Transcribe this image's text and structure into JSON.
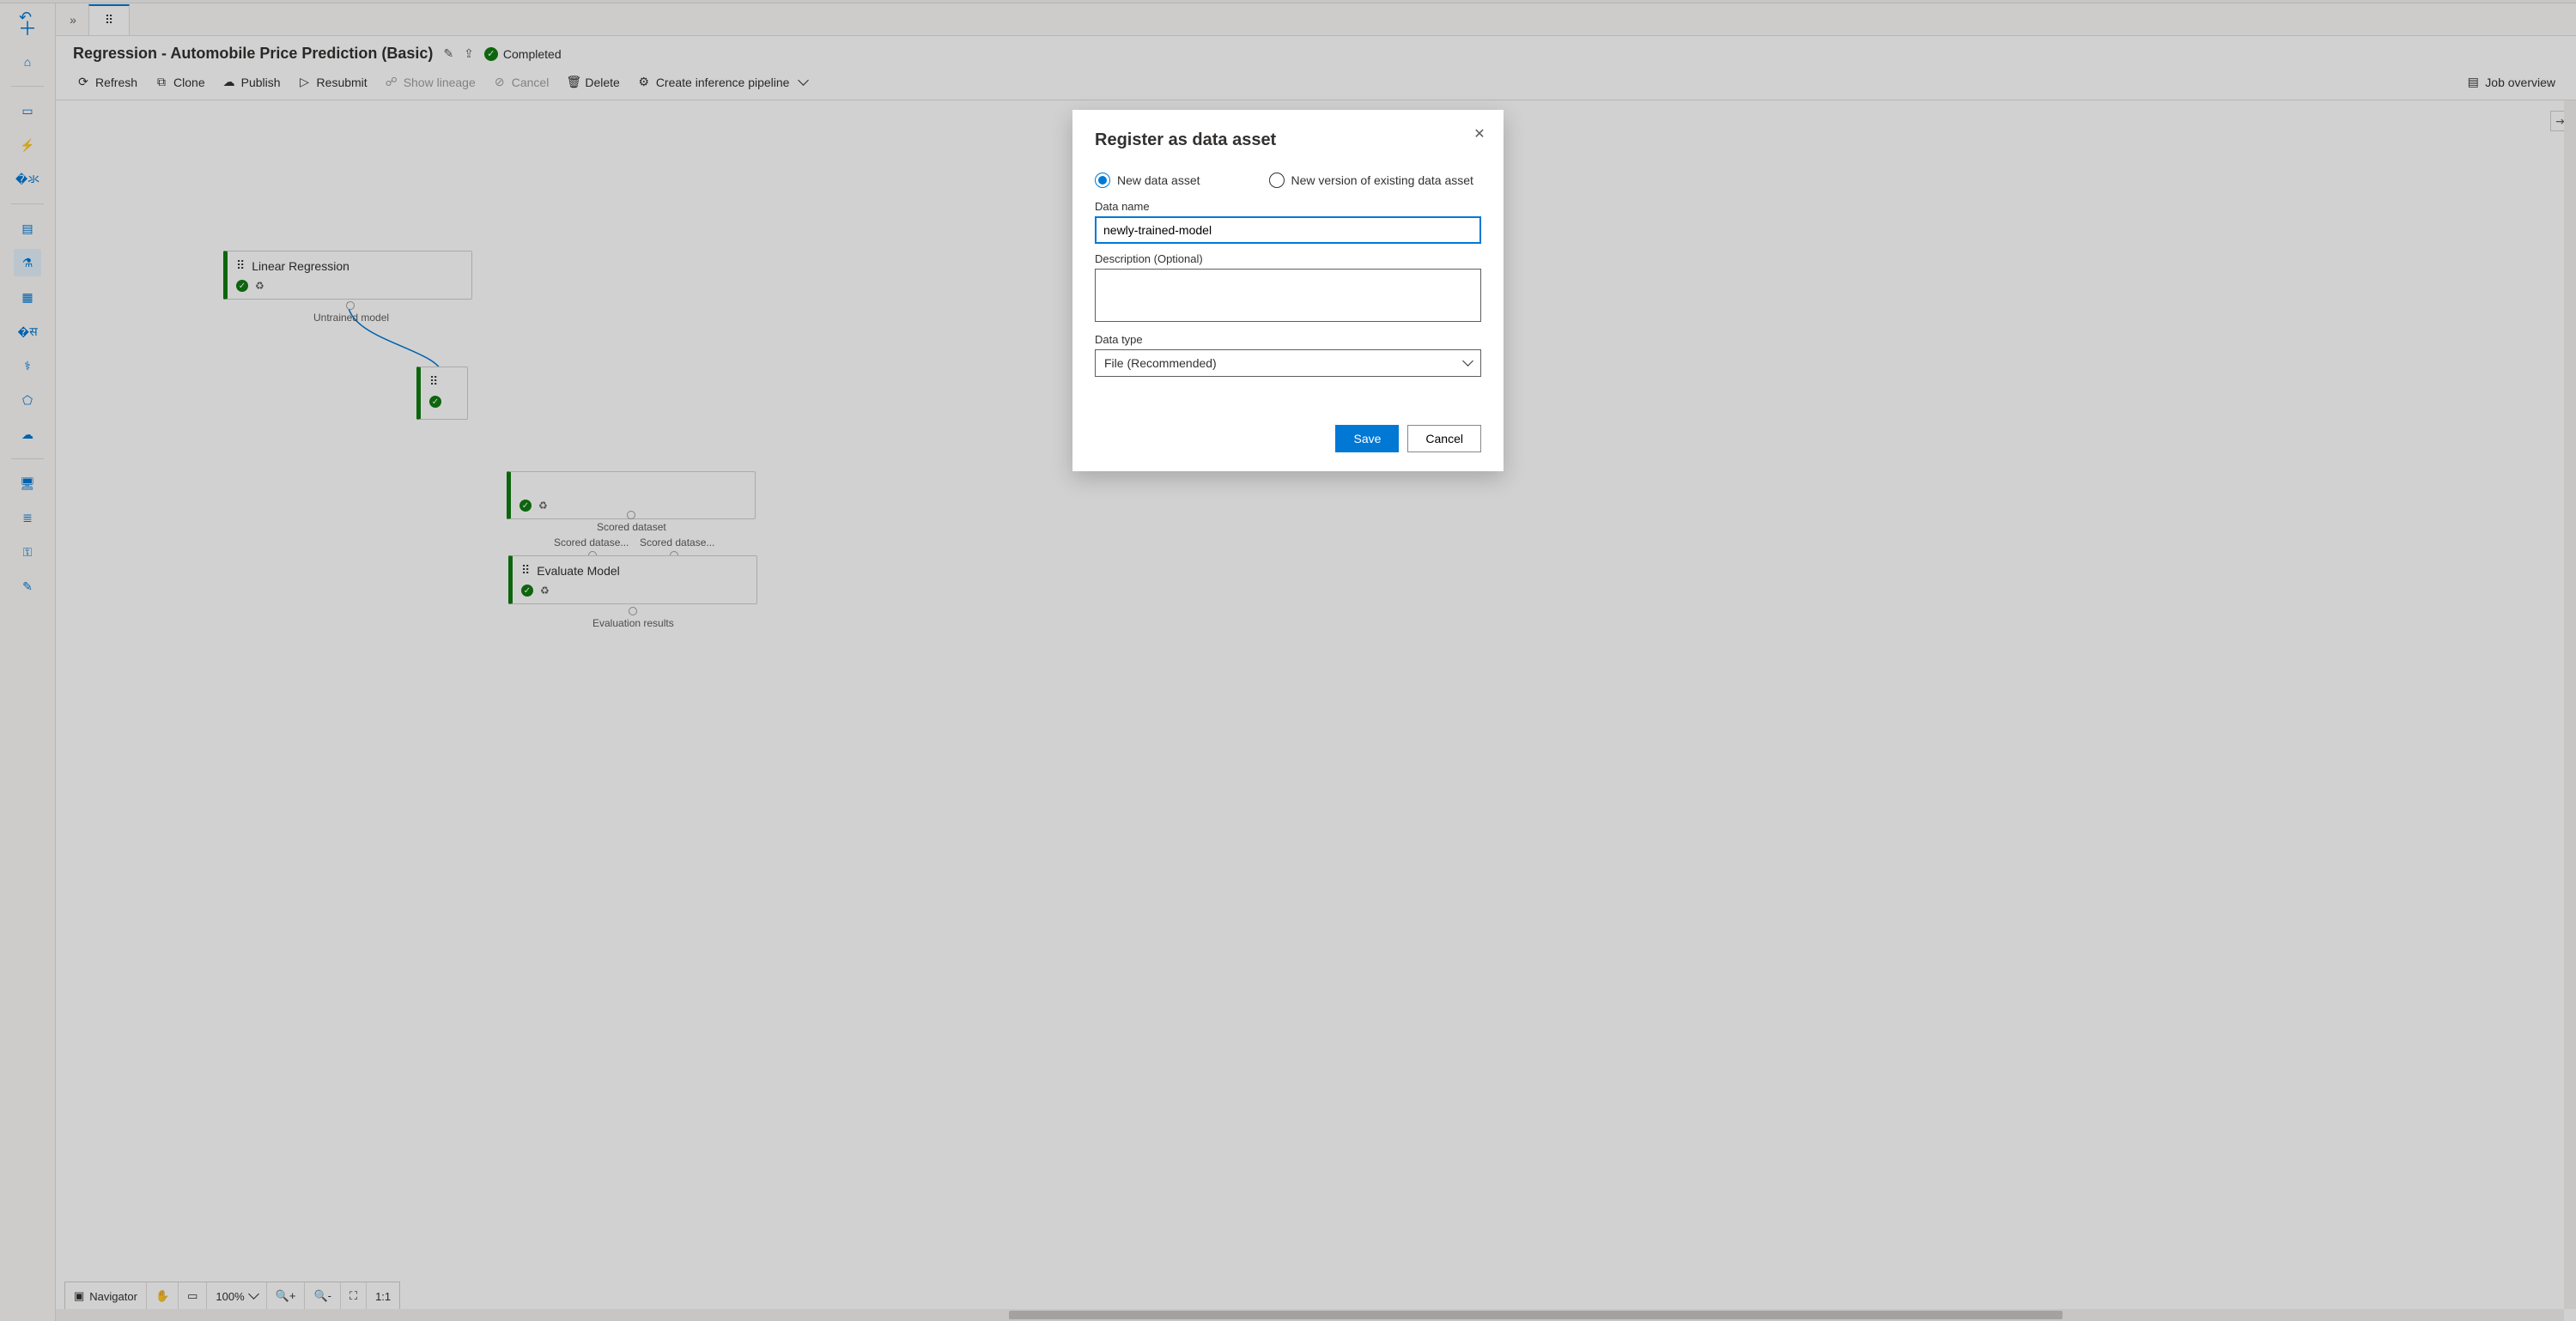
{
  "pipeline": {
    "title": "Regression - Automobile Price Prediction (Basic)",
    "status": "Completed"
  },
  "toolbar": {
    "refresh": "Refresh",
    "clone": "Clone",
    "publish": "Publish",
    "resubmit": "Resubmit",
    "show_lineage": "Show lineage",
    "cancel": "Cancel",
    "delete": "Delete",
    "create_inference": "Create inference pipeline",
    "job_overview": "Job overview"
  },
  "navigator": {
    "label": "Navigator",
    "zoom": "100%"
  },
  "nodes": {
    "linear_regression": "Linear Regression",
    "evaluate_model": "Evaluate Model"
  },
  "port_labels": {
    "untrained_model": "Untrained model",
    "scored_dataset": "Scored dataset",
    "scored_dataset_left": "Scored datase...",
    "scored_dataset_right": "Scored datase...",
    "evaluation_results": "Evaluation results"
  },
  "dialog": {
    "title": "Register as data asset",
    "radio_new": "New data asset",
    "radio_version": "New version of existing data asset",
    "data_name_label": "Data name",
    "data_name_value": "newly-trained-model",
    "description_label": "Description (Optional)",
    "description_value": "",
    "data_type_label": "Data type",
    "data_type_value": "File (Recommended)",
    "save": "Save",
    "cancel": "Cancel"
  }
}
